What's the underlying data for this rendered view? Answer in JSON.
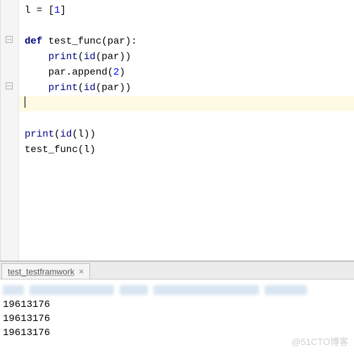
{
  "editor": {
    "lines": {
      "l1": "l = [",
      "l1_num": "1",
      "l1_end": "]",
      "l2": "",
      "l3_def": "def",
      "l3_rest": " test_func(par):",
      "l4_indent": "    ",
      "l4_print": "print",
      "l4_open": "(",
      "l4_id": "id",
      "l4_close": "(par))",
      "l5_indent": "    par.append(",
      "l5_num": "2",
      "l5_end": ")",
      "l6_indent": "    ",
      "l6_print": "print",
      "l6_open": "(",
      "l6_id": "id",
      "l6_close": "(par))",
      "l7": "",
      "l8": "",
      "l9_print": "print",
      "l9_open": "(",
      "l9_id": "id",
      "l9_close": "(l))",
      "l10": "test_func(l)"
    }
  },
  "tab": {
    "label": "test_testframwork",
    "close": "×"
  },
  "console": {
    "out1": "19613176",
    "out2": "19613176",
    "out3": "19613176"
  },
  "watermark": "@51CTO博客"
}
